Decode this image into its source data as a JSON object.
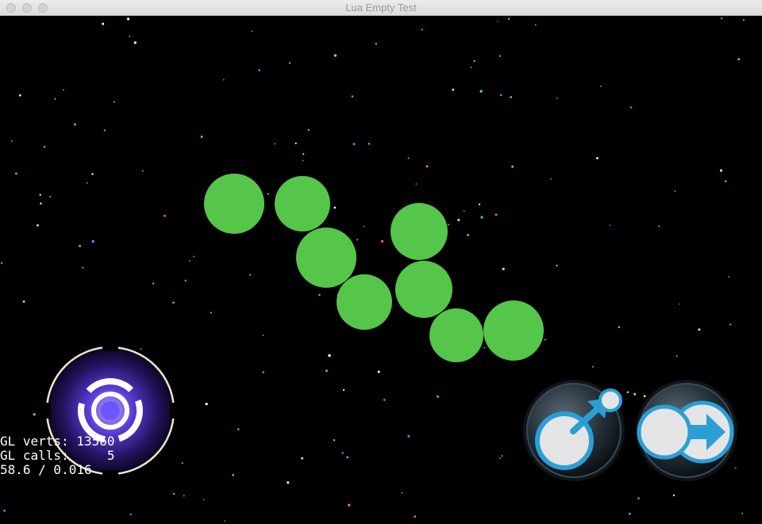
{
  "window": {
    "title": "Lua Empty Test"
  },
  "colors": {
    "ball": "#55c64a",
    "background": "#000000",
    "joystick_glow": "#5b3bd6",
    "button_accent": "#2a9fd6"
  },
  "controls": {
    "joystick": {
      "icon": "virtual-joystick-icon"
    },
    "buttons": [
      {
        "name": "jump-button",
        "icon": "circle-arrow-up-right-icon"
      },
      {
        "name": "dash-button",
        "icon": "circle-arrow-right-icon"
      }
    ]
  },
  "stats": {
    "line1": "GL verts: 13560",
    "line2": "GL calls:     5",
    "line3": "58.6 / 0.016"
  }
}
